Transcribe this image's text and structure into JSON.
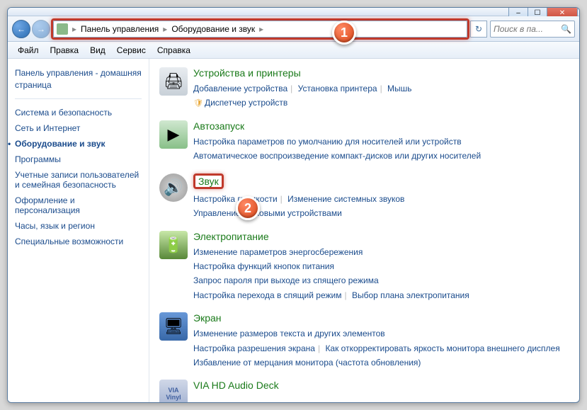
{
  "window": {
    "min": "–",
    "max": "☐",
    "close": "✕"
  },
  "nav": {
    "back": "←",
    "forward": "→",
    "refresh": "↻"
  },
  "breadcrumb": {
    "seg1": "Панель управления",
    "seg2": "Оборудование и звук"
  },
  "search": {
    "placeholder": "Поиск в па..."
  },
  "menu": {
    "file": "Файл",
    "edit": "Правка",
    "view": "Вид",
    "tools": "Сервис",
    "help": "Справка"
  },
  "sidebar": {
    "home": "Панель управления - домашняя страница",
    "items": [
      {
        "label": "Система и безопасность"
      },
      {
        "label": "Сеть и Интернет"
      },
      {
        "label": "Оборудование и звук"
      },
      {
        "label": "Программы"
      },
      {
        "label": "Учетные записи пользователей и семейная безопасность"
      },
      {
        "label": "Оформление и персонализация"
      },
      {
        "label": "Часы, язык и регион"
      },
      {
        "label": "Специальные возможности"
      }
    ]
  },
  "sections": {
    "devices": {
      "title": "Устройства и принтеры",
      "links": [
        "Добавление устройства",
        "Установка принтера",
        "Мышь",
        "Диспетчер устройств"
      ]
    },
    "autoplay": {
      "title": "Автозапуск",
      "links": [
        "Настройка параметров по умолчанию для носителей или устройств",
        "Автоматическое воспроизведение компакт-дисков или других носителей"
      ]
    },
    "sound": {
      "title": "Звук",
      "links": [
        "Настройка громкости",
        "Изменение системных звуков",
        "Управление звуковыми устройствами"
      ]
    },
    "power": {
      "title": "Электропитание",
      "links": [
        "Изменение параметров энергосбережения",
        "Настройка функций кнопок питания",
        "Запрос пароля при выходе из спящего режима",
        "Настройка перехода в спящий режим",
        "Выбор плана электропитания"
      ]
    },
    "display": {
      "title": "Экран",
      "links": [
        "Изменение размеров текста и других элементов",
        "Настройка разрешения экрана",
        "Как откорректировать яркость монитора внешнего дисплея",
        "Избавление от мерцания монитора (частота обновления)"
      ]
    },
    "via": {
      "title": "VIA HD Audio Deck"
    }
  },
  "callouts": {
    "c1": "1",
    "c2": "2"
  }
}
